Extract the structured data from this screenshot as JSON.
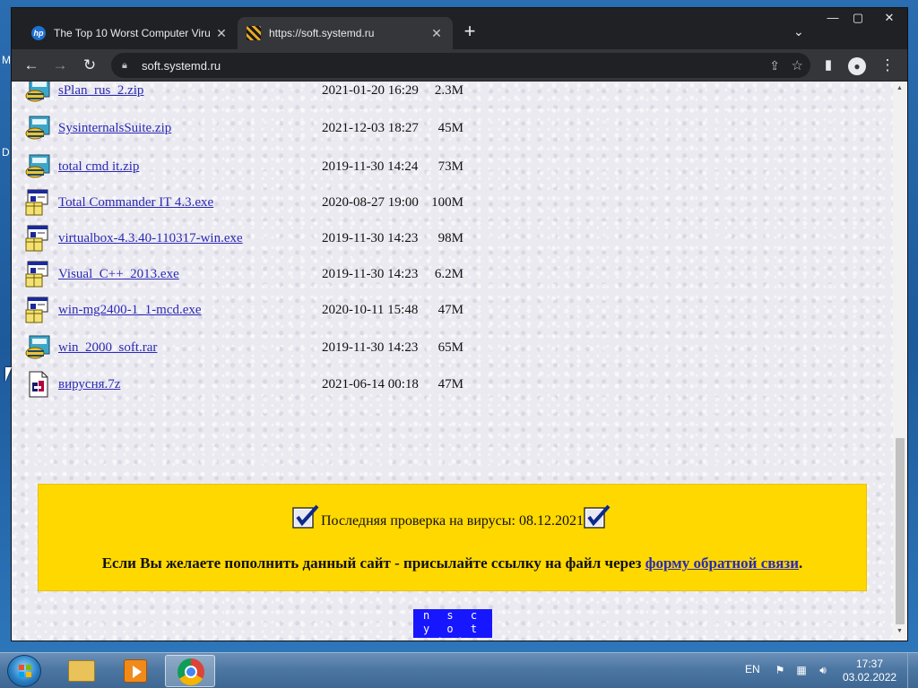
{
  "desktop": {
    "letter_top": "M",
    "letter_mid": "D"
  },
  "browser": {
    "tabs": [
      {
        "title": "The Top 10 Worst Computer Viru",
        "icon": "hp-favicon-icon",
        "active": false
      },
      {
        "title": "https://soft.systemd.ru",
        "icon": "striped-favicon-icon",
        "active": true
      }
    ],
    "new_tab_label": "+",
    "address": "soft.systemd.ru"
  },
  "page": {
    "files": [
      {
        "name": "sPlan_rus_2.zip",
        "date": "2021-01-20 16:29",
        "size": "2.3M",
        "icon": "zip-archive-icon"
      },
      {
        "name": "SysinternalsSuite.zip",
        "date": "2021-12-03 18:27",
        "size": "45M",
        "icon": "zip-archive-icon"
      },
      {
        "name": "total cmd it.zip",
        "date": "2019-11-30 14:24",
        "size": "73M",
        "icon": "zip-archive-icon"
      },
      {
        "name": "Total Commander IT 4.3.exe",
        "date": "2020-08-27 19:00",
        "size": "100M",
        "icon": "installer-exe-icon"
      },
      {
        "name": "virtualbox-4.3.40-110317-win.exe",
        "date": "2019-11-30 14:23",
        "size": "98M",
        "icon": "installer-exe-icon"
      },
      {
        "name": "Visual_C++_2013.exe",
        "date": "2019-11-30 14:23",
        "size": "6.2M",
        "icon": "installer-exe-icon"
      },
      {
        "name": "win-mg2400-1_1-mcd.exe",
        "date": "2020-10-11 15:48",
        "size": "47M",
        "icon": "installer-exe-icon"
      },
      {
        "name": "win_2000_soft.rar",
        "date": "2019-11-30 14:23",
        "size": "65M",
        "icon": "zip-archive-icon"
      },
      {
        "name": "вирусня.7z",
        "date": "2021-06-14 00:18",
        "size": "47M",
        "icon": "binary-file-icon"
      }
    ],
    "banner": {
      "check_text": "Последняя проверка на вирусы: 08.12.2021",
      "info_prefix": "Если Вы желаете пополнить данный сайт - присылайте ссылку на файл через ",
      "info_link": "форму обратной связи",
      "info_suffix": "."
    },
    "counter_text": "n s c y  o t d b"
  },
  "taskbar": {
    "language": "EN",
    "time": "17:37",
    "date": "03.02.2022"
  },
  "colors": {
    "banner_bg": "#ffd800",
    "link": "#2a2ab4",
    "counter_bg": "#1717ff",
    "browser_frame": "#202124"
  }
}
